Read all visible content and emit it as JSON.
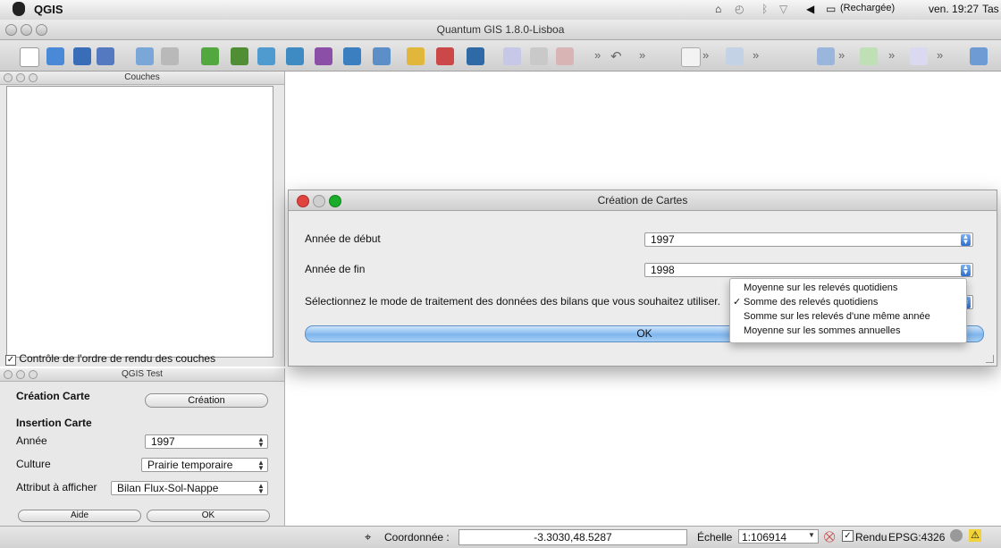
{
  "menubar": {
    "app_name": "QGIS",
    "reload_status": "(Rechargée)",
    "clock": "ven. 19:27",
    "user_truncated": "Tas"
  },
  "main_window": {
    "title": "Quantum GIS 1.8.0-Lisboa"
  },
  "toolbar": {
    "icons": [
      "new-project-icon",
      "open-project-icon",
      "save-project-icon",
      "save-as-icon",
      "print-composer-icon",
      "print-icon",
      "add-vector-layer-icon",
      "add-raster-layer-icon",
      "add-postgis-layer-icon",
      "add-spatialite-layer-icon",
      "add-mssql-layer-icon",
      "add-wms-layer-icon",
      "add-wfs-layer-icon",
      "new-shapefile-icon",
      "remove-layer-icon",
      "new-gpx-icon",
      "edit-pencil-icon",
      "save-edits-icon",
      "digitize-icon",
      "undo-icon",
      "pan-icon",
      "identify-icon",
      "magnet-icon",
      "feature-action-icon",
      "label-icon",
      "plugin-db-icon"
    ],
    "overflow_label": "»"
  },
  "couches_panel": {
    "title": "Couches",
    "render_order_checkbox_label": "Contrôle de l'ordre de rendu des couches",
    "render_order_checked": true
  },
  "qgis_test_panel": {
    "title": "QGIS Test",
    "creation_carte_label": "Création Carte",
    "creation_button": "Création",
    "insertion_carte_label": "Insertion Carte",
    "annee_label": "Année",
    "annee_value": "1997",
    "culture_label": "Culture",
    "culture_value": "Prairie temporaire",
    "attribut_label": "Attribut à afficher",
    "attribut_value": "Bilan Flux-Sol-Nappe",
    "aide_button": "Aide",
    "ok_button": "OK"
  },
  "dialog": {
    "title": "Création de Cartes",
    "annee_debut_label": "Année de début",
    "annee_debut_value": "1997",
    "annee_fin_label": "Année de fin",
    "annee_fin_value": "1998",
    "mode_label": "Sélectionnez le mode de traitement des données des bilans que vous souhaitez utiliser.",
    "ok_button": "OK",
    "mode_options": [
      {
        "label": "Moyenne sur les relevés quotidiens",
        "checked": false
      },
      {
        "label": "Somme des relevés quotidiens",
        "checked": true
      },
      {
        "label": "Somme sur les relevés d'une même année",
        "checked": false
      },
      {
        "label": "Moyenne sur les sommes annuelles",
        "checked": false
      }
    ],
    "check_mark": "✓"
  },
  "statusbar": {
    "coordinate_label": "Coordonnée :",
    "coordinate_value": "-3.3030,48.5287",
    "scale_label": "Échelle",
    "scale_value": "1:106914",
    "render_label": "Rendu",
    "render_checked": true,
    "crs_label": "EPSG:4326"
  },
  "colors": {
    "close_red": "#e0443e",
    "minimize_yellow": "#dea123",
    "zoom_green": "#1aad2a",
    "ok_blue": "#7fb6ee"
  }
}
